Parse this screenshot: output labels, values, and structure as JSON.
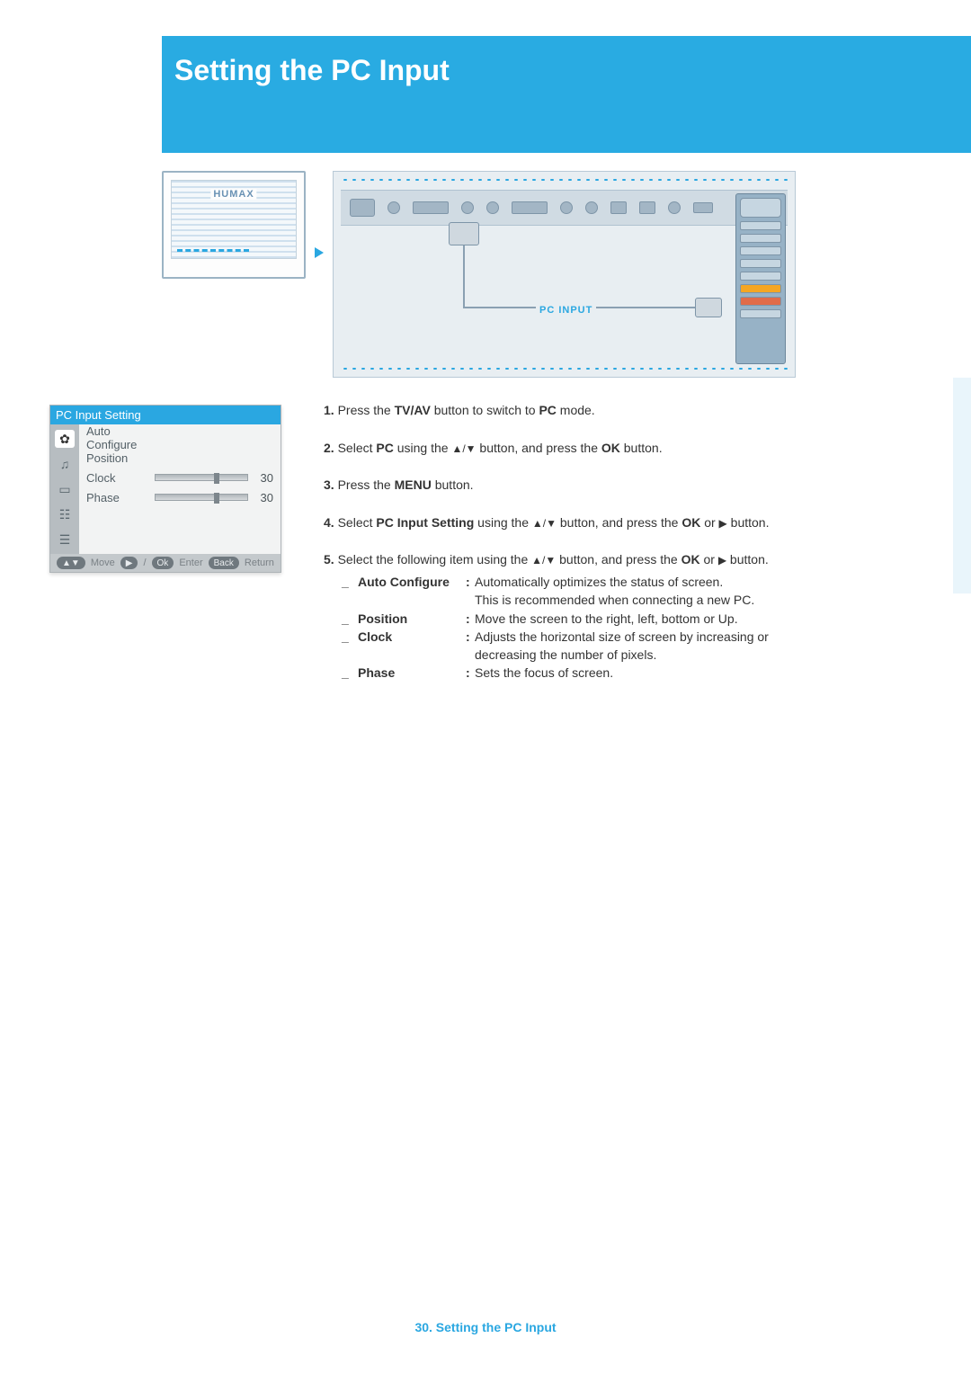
{
  "header": {
    "title": "Setting the PC Input"
  },
  "tv": {
    "brand": "HUMAX"
  },
  "panel": {
    "pc_input_label": "PC INPUT"
  },
  "menu": {
    "title": "PC Input Setting",
    "items": {
      "auto": "Auto Configure",
      "position": "Position",
      "clock": {
        "label": "Clock",
        "value": "30"
      },
      "phase": {
        "label": "Phase",
        "value": "30"
      }
    },
    "footer": {
      "move": "Move",
      "enter": "Enter",
      "back_pill": "Back",
      "back": "Return",
      "ok_pill": "Ok"
    }
  },
  "steps": {
    "s1": {
      "num": "1.",
      "t1": "Press the ",
      "b1": "TV/AV",
      "t2": " button to switch to ",
      "b2": "PC",
      "t3": " mode."
    },
    "s2": {
      "num": "2.",
      "t1": "Select ",
      "b1": "PC",
      "t2": " using the ",
      "arrows": "▲/▼",
      "t3": " button, and press the ",
      "b2": "OK",
      "t4": " button."
    },
    "s3": {
      "num": "3.",
      "t1": "Press the ",
      "b1": "MENU",
      "t2": " button."
    },
    "s4": {
      "num": "4.",
      "t1": "Select ",
      "b1": "PC Input Setting",
      "t2": " using the ",
      "arrows": "▲/▼",
      "t3": " button, and press the ",
      "b2": "OK",
      "t4": " or ",
      "ar": "▶",
      "t5": " button."
    },
    "s5": {
      "num": "5.",
      "t1": "Select the following item using the ",
      "arrows": "▲/▼",
      "t2": " button, and press the ",
      "b1": "OK",
      "t3": " or ",
      "ar": "▶",
      "t4": " button."
    }
  },
  "defs": {
    "auto": {
      "term": "Auto Configure",
      "desc1": "Automatically optimizes the status of screen.",
      "desc2": "This is recommended when connecting a new PC."
    },
    "position": {
      "term": "Position",
      "desc": "Move the screen to the right, left, bottom or Up."
    },
    "clock": {
      "term": "Clock",
      "desc1": "Adjusts the horizontal size of screen by increasing or",
      "desc2": "decreasing the number of pixels."
    },
    "phase": {
      "term": "Phase",
      "desc": "Sets the focus of screen."
    }
  },
  "footer": {
    "page": "30.",
    "title": "Setting the PC Input"
  }
}
